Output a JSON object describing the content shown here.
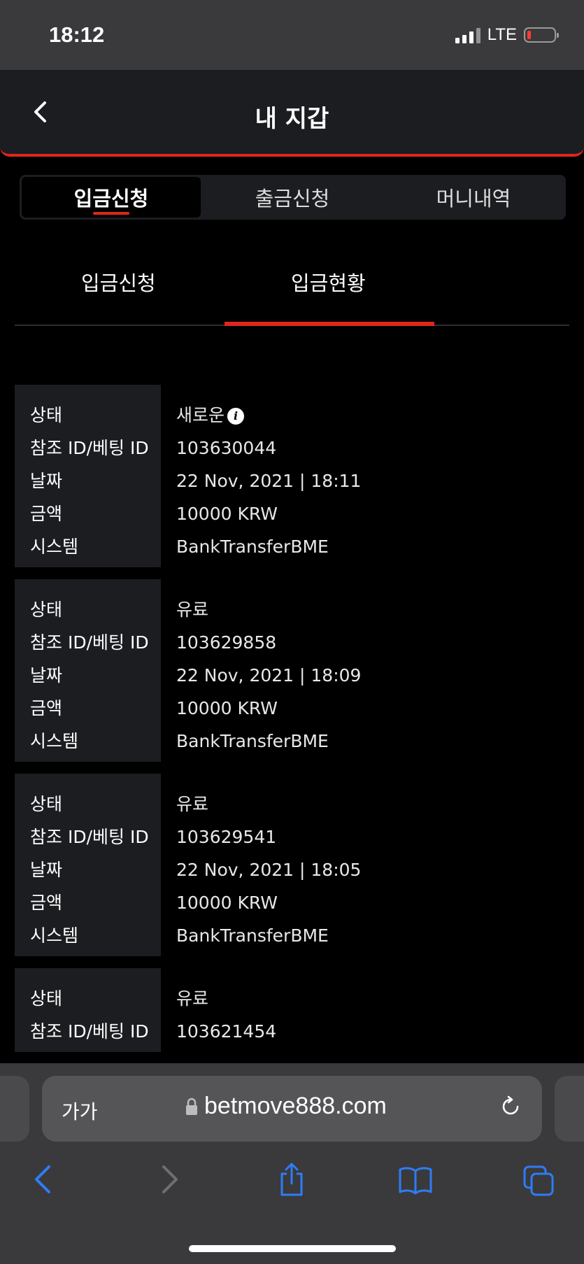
{
  "status_bar": {
    "time": "18:12",
    "network": "LTE"
  },
  "header": {
    "title": "내 지갑"
  },
  "segment_tabs": [
    {
      "label": "입금신청",
      "active": true
    },
    {
      "label": "출금신청",
      "active": false
    },
    {
      "label": "머니내역",
      "active": false
    }
  ],
  "sub_tabs": [
    {
      "label": "입금신청",
      "active": false
    },
    {
      "label": "입금현황",
      "active": true
    }
  ],
  "field_labels": {
    "status": "상태",
    "ref_id": "참조 ID/베팅 ID",
    "date": "날짜",
    "amount": "금액",
    "system": "시스템"
  },
  "records": [
    {
      "status": "새로운",
      "ref_id": "103630044",
      "date": "22 Nov, 2021 | 18:11",
      "amount": "10000 KRW",
      "system": "BankTransferBME"
    },
    {
      "status": "유료",
      "ref_id": "103629858",
      "date": "22 Nov, 2021 | 18:09",
      "amount": "10000 KRW",
      "system": "BankTransferBME"
    },
    {
      "status": "유료",
      "ref_id": "103629541",
      "date": "22 Nov, 2021 | 18:05",
      "amount": "10000 KRW",
      "system": "BankTransferBME"
    },
    {
      "status": "유료",
      "ref_id": "103621454"
    }
  ],
  "browser": {
    "text_size_label": "가가",
    "url": "betmove888.com"
  },
  "colors": {
    "accent": "#e1261c",
    "ios_blue": "#2f7cf6",
    "panel": "#1c1d21"
  }
}
